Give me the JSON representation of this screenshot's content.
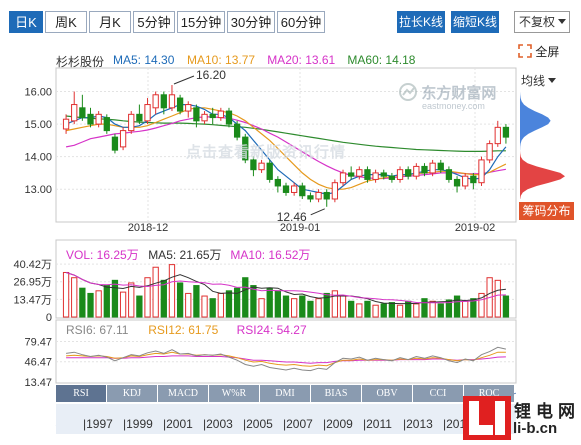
{
  "toolbar": {
    "period_tabs": [
      "日K",
      "周K",
      "月K",
      "5分钟",
      "15分钟",
      "30分钟",
      "60分钟"
    ],
    "active_tab": "日K",
    "stretch_button": "拉长K线",
    "shrink_button": "缩短K线",
    "adjust_select": "不复权",
    "fullscreen_label": "全屏"
  },
  "side": {
    "ma_label": "均线",
    "chip_label": "筹码分布"
  },
  "watermark": {
    "brand": "东方财富网",
    "domain": "eastmoney.com",
    "overlay_text": "点击查看新版资讯行情"
  },
  "price_panel": {
    "stock_name": "杉杉股份",
    "ma_legend": [
      {
        "label": "MA5:",
        "value": "14.30",
        "color": "#1e6bb8"
      },
      {
        "label": "MA10:",
        "value": "13.77",
        "color": "#e69a1e"
      },
      {
        "label": "MA20:",
        "value": "13.61",
        "color": "#d633c8"
      },
      {
        "label": "MA60:",
        "value": "14.18",
        "color": "#2e8b2e"
      }
    ],
    "high_annotation": "16.20",
    "low_annotation": "12.46",
    "y_ticks": [
      "16.00",
      "15.00",
      "14.00",
      "13.00"
    ],
    "x_ticks": [
      "2018-12",
      "2019-01",
      "2019-02"
    ]
  },
  "volume_panel": {
    "legend": [
      {
        "label": "VOL:",
        "value": "16.25万",
        "color": "#d633c8"
      },
      {
        "label": "MA5:",
        "value": "21.65万",
        "color": "#333333"
      },
      {
        "label": "MA10:",
        "value": "16.52万",
        "color": "#d633c8"
      }
    ],
    "y_ticks": [
      "40.42万",
      "26.95万",
      "13.47万",
      "0"
    ]
  },
  "rsi_panel": {
    "legend": [
      {
        "label": "RSI6:",
        "value": "67.11",
        "color": "#888888"
      },
      {
        "label": "RSI12:",
        "value": "61.75",
        "color": "#e69a1e"
      },
      {
        "label": "RSI24:",
        "value": "54.27",
        "color": "#d633c8"
      }
    ],
    "y_ticks": [
      "79.47",
      "46.47",
      "13.47"
    ]
  },
  "indicator_tabs": [
    "RSI",
    "KDJ",
    "MACD",
    "W%R",
    "DMI",
    "BIAS",
    "OBV",
    "CCI",
    "ROC"
  ],
  "active_indicator": "RSI",
  "timeline_years": [
    "1997",
    "1999",
    "2001",
    "2003",
    "2005",
    "2007",
    "2009",
    "2011",
    "2013",
    "2015"
  ],
  "site_logo": {
    "name": "锂电网",
    "url": "li-b.cn"
  },
  "colors": {
    "up": "#e03030",
    "down": "#1a8a1a",
    "accent": "#1e6bb8"
  },
  "chart_data": {
    "type": "candlestick",
    "ylim": [
      12.3,
      16.6
    ],
    "candles": [
      {
        "o": 14.85,
        "c": 15.15,
        "h": 15.3,
        "l": 14.7
      },
      {
        "o": 15.1,
        "c": 15.6,
        "h": 16.0,
        "l": 15.0
      },
      {
        "o": 15.5,
        "c": 15.2,
        "h": 15.9,
        "l": 15.1
      },
      {
        "o": 15.3,
        "c": 15.0,
        "h": 15.5,
        "l": 14.9
      },
      {
        "o": 15.0,
        "c": 15.3,
        "h": 15.4,
        "l": 14.9
      },
      {
        "o": 15.2,
        "c": 14.8,
        "h": 15.3,
        "l": 14.7
      },
      {
        "o": 14.6,
        "c": 14.2,
        "h": 14.7,
        "l": 14.1
      },
      {
        "o": 14.3,
        "c": 14.8,
        "h": 14.9,
        "l": 14.2
      },
      {
        "o": 14.8,
        "c": 15.3,
        "h": 15.4,
        "l": 14.7
      },
      {
        "o": 15.3,
        "c": 15.1,
        "h": 15.6,
        "l": 15.0
      },
      {
        "o": 15.1,
        "c": 15.6,
        "h": 15.8,
        "l": 15.0
      },
      {
        "o": 15.5,
        "c": 15.9,
        "h": 16.0,
        "l": 15.3
      },
      {
        "o": 15.9,
        "c": 15.5,
        "h": 16.0,
        "l": 15.3
      },
      {
        "o": 15.5,
        "c": 15.9,
        "h": 16.2,
        "l": 15.4
      },
      {
        "o": 15.8,
        "c": 15.4,
        "h": 15.9,
        "l": 15.3
      },
      {
        "o": 15.4,
        "c": 15.6,
        "h": 15.7,
        "l": 15.2
      },
      {
        "o": 15.5,
        "c": 15.1,
        "h": 15.6,
        "l": 14.9
      },
      {
        "o": 15.1,
        "c": 15.3,
        "h": 15.4,
        "l": 15.0
      },
      {
        "o": 15.3,
        "c": 15.2,
        "h": 15.5,
        "l": 15.0
      },
      {
        "o": 15.2,
        "c": 15.4,
        "h": 15.5,
        "l": 15.1
      },
      {
        "o": 15.4,
        "c": 15.0,
        "h": 15.5,
        "l": 14.9
      },
      {
        "o": 15.0,
        "c": 14.6,
        "h": 15.1,
        "l": 14.5
      },
      {
        "o": 14.6,
        "c": 13.9,
        "h": 14.7,
        "l": 13.8
      },
      {
        "o": 13.9,
        "c": 13.6,
        "h": 14.0,
        "l": 13.4
      },
      {
        "o": 13.6,
        "c": 13.8,
        "h": 13.9,
        "l": 13.5
      },
      {
        "o": 13.8,
        "c": 13.3,
        "h": 13.9,
        "l": 13.2
      },
      {
        "o": 13.3,
        "c": 13.1,
        "h": 13.4,
        "l": 12.9
      },
      {
        "o": 13.1,
        "c": 12.9,
        "h": 13.2,
        "l": 12.8
      },
      {
        "o": 12.9,
        "c": 13.1,
        "h": 13.2,
        "l": 12.8
      },
      {
        "o": 13.1,
        "c": 12.8,
        "h": 13.2,
        "l": 12.7
      },
      {
        "o": 12.8,
        "c": 12.7,
        "h": 12.9,
        "l": 12.6
      },
      {
        "o": 12.7,
        "c": 12.9,
        "h": 13.0,
        "l": 12.6
      },
      {
        "o": 12.9,
        "c": 12.7,
        "h": 13.0,
        "l": 12.46
      },
      {
        "o": 12.7,
        "c": 13.2,
        "h": 13.3,
        "l": 12.6
      },
      {
        "o": 13.2,
        "c": 13.5,
        "h": 13.6,
        "l": 13.1
      },
      {
        "o": 13.5,
        "c": 13.4,
        "h": 13.7,
        "l": 13.3
      },
      {
        "o": 13.4,
        "c": 13.6,
        "h": 13.7,
        "l": 13.3
      },
      {
        "o": 13.6,
        "c": 13.3,
        "h": 13.7,
        "l": 13.2
      },
      {
        "o": 13.3,
        "c": 13.5,
        "h": 13.6,
        "l": 13.2
      },
      {
        "o": 13.5,
        "c": 13.4,
        "h": 13.6,
        "l": 13.3
      },
      {
        "o": 13.4,
        "c": 13.3,
        "h": 13.5,
        "l": 13.2
      },
      {
        "o": 13.3,
        "c": 13.6,
        "h": 13.7,
        "l": 13.2
      },
      {
        "o": 13.6,
        "c": 13.4,
        "h": 13.7,
        "l": 13.3
      },
      {
        "o": 13.4,
        "c": 13.7,
        "h": 13.8,
        "l": 13.3
      },
      {
        "o": 13.7,
        "c": 13.5,
        "h": 13.8,
        "l": 13.4
      },
      {
        "o": 13.5,
        "c": 13.8,
        "h": 13.9,
        "l": 13.4
      },
      {
        "o": 13.8,
        "c": 13.6,
        "h": 13.9,
        "l": 13.5
      },
      {
        "o": 13.6,
        "c": 13.3,
        "h": 13.7,
        "l": 13.2
      },
      {
        "o": 13.3,
        "c": 13.1,
        "h": 13.4,
        "l": 12.9
      },
      {
        "o": 13.1,
        "c": 13.4,
        "h": 13.5,
        "l": 13.0
      },
      {
        "o": 13.4,
        "c": 13.2,
        "h": 13.5,
        "l": 13.0
      },
      {
        "o": 13.2,
        "c": 13.9,
        "h": 14.0,
        "l": 13.1
      },
      {
        "o": 13.9,
        "c": 14.4,
        "h": 14.5,
        "l": 13.8
      },
      {
        "o": 14.4,
        "c": 14.9,
        "h": 15.1,
        "l": 14.3
      },
      {
        "o": 14.9,
        "c": 14.6,
        "h": 15.0,
        "l": 14.4
      }
    ],
    "ma5": [
      15.0,
      15.1,
      15.2,
      15.2,
      15.25,
      15.2,
      15.0,
      14.9,
      14.9,
      14.95,
      15.1,
      15.3,
      15.4,
      15.5,
      15.6,
      15.6,
      15.55,
      15.45,
      15.3,
      15.3,
      15.2,
      15.0,
      14.8,
      14.5,
      14.2,
      13.9,
      13.6,
      13.4,
      13.2,
      13.0,
      12.95,
      12.9,
      12.85,
      12.9,
      13.1,
      13.3,
      13.4,
      13.45,
      13.45,
      13.45,
      13.4,
      13.45,
      13.45,
      13.5,
      13.55,
      13.6,
      13.6,
      13.55,
      13.45,
      13.35,
      13.3,
      13.35,
      13.6,
      14.0,
      14.3
    ],
    "ma10": [
      14.8,
      14.85,
      14.9,
      14.95,
      15.0,
      15.0,
      14.95,
      14.9,
      14.9,
      14.9,
      14.95,
      15.05,
      15.15,
      15.25,
      15.35,
      15.45,
      15.5,
      15.5,
      15.45,
      15.4,
      15.35,
      15.25,
      15.1,
      14.9,
      14.7,
      14.5,
      14.25,
      14.0,
      13.75,
      13.5,
      13.3,
      13.15,
      13.05,
      13.0,
      13.0,
      13.05,
      13.15,
      13.25,
      13.3,
      13.35,
      13.4,
      13.42,
      13.45,
      13.48,
      13.5,
      13.52,
      13.55,
      13.55,
      13.52,
      13.48,
      13.45,
      13.45,
      13.52,
      13.65,
      13.77
    ],
    "ma20": [
      14.3,
      14.35,
      14.45,
      14.55,
      14.6,
      14.65,
      14.7,
      14.72,
      14.75,
      14.78,
      14.82,
      14.88,
      14.95,
      15.02,
      15.1,
      15.15,
      15.2,
      15.22,
      15.22,
      15.2,
      15.18,
      15.12,
      15.05,
      14.95,
      14.85,
      14.72,
      14.6,
      14.45,
      14.3,
      14.15,
      14.0,
      13.85,
      13.72,
      13.6,
      13.5,
      13.42,
      13.38,
      13.35,
      13.33,
      13.33,
      13.35,
      13.38,
      13.4,
      13.42,
      13.45,
      13.47,
      13.5,
      13.5,
      13.5,
      13.48,
      13.47,
      13.48,
      13.52,
      13.57,
      13.61
    ],
    "ma60": [
      15.25,
      15.22,
      15.2,
      15.18,
      15.16,
      15.15,
      15.13,
      15.1,
      15.08,
      15.06,
      15.05,
      15.04,
      15.03,
      15.03,
      15.03,
      15.02,
      15.01,
      15.0,
      14.98,
      14.96,
      14.94,
      14.92,
      14.9,
      14.87,
      14.84,
      14.8,
      14.76,
      14.72,
      14.68,
      14.64,
      14.6,
      14.56,
      14.52,
      14.48,
      14.44,
      14.41,
      14.38,
      14.35,
      14.32,
      14.3,
      14.28,
      14.26,
      14.24,
      14.22,
      14.21,
      14.2,
      14.19,
      14.18,
      14.17,
      14.16,
      14.16,
      14.16,
      14.17,
      14.18,
      14.18
    ],
    "volume": [
      34,
      30,
      22,
      18,
      20,
      24,
      28,
      19,
      26,
      16,
      30,
      38,
      28,
      40,
      26,
      18,
      24,
      16,
      14,
      18,
      20,
      22,
      30,
      24,
      14,
      22,
      20,
      16,
      14,
      16,
      12,
      14,
      18,
      20,
      16,
      12,
      10,
      12,
      9,
      10,
      11,
      9,
      12,
      10,
      14,
      12,
      10,
      13,
      16,
      12,
      14,
      18,
      30,
      28,
      16
    ],
    "vol_ylim": [
      0,
      42
    ],
    "rsi6": [
      60,
      62,
      58,
      55,
      57,
      54,
      48,
      53,
      58,
      56,
      61,
      64,
      60,
      66,
      59,
      60,
      56,
      58,
      57,
      59,
      54,
      49,
      42,
      39,
      42,
      37,
      35,
      33,
      36,
      33,
      32,
      36,
      34,
      45,
      52,
      51,
      54,
      49,
      52,
      50,
      48,
      53,
      50,
      55,
      52,
      56,
      53,
      48,
      45,
      51,
      48,
      58,
      63,
      70,
      67
    ],
    "rsi12": [
      56,
      57,
      56,
      55,
      56,
      55,
      52,
      53,
      56,
      55,
      58,
      60,
      59,
      62,
      59,
      59,
      57,
      58,
      57,
      58,
      56,
      53,
      49,
      46,
      47,
      44,
      42,
      41,
      42,
      40,
      39,
      41,
      40,
      45,
      49,
      49,
      51,
      49,
      50,
      50,
      49,
      51,
      50,
      52,
      51,
      53,
      52,
      50,
      48,
      50,
      49,
      53,
      57,
      62,
      61.75
    ],
    "rsi24": [
      53,
      53,
      53,
      53,
      53,
      53,
      52,
      52,
      53,
      53,
      54,
      55,
      55,
      56,
      56,
      56,
      55,
      55,
      55,
      55,
      54,
      53,
      51,
      49,
      49,
      48,
      47,
      46,
      46,
      45,
      44,
      45,
      45,
      47,
      48,
      48,
      49,
      49,
      49,
      49,
      49,
      50,
      50,
      50,
      50,
      51,
      51,
      50,
      49,
      50,
      50,
      51,
      52,
      54,
      54.27
    ],
    "rsi_ylim": [
      13.47,
      90
    ]
  }
}
